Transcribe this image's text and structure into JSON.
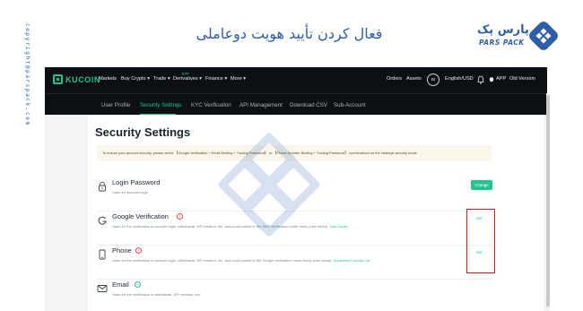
{
  "header": {
    "title": "فعال کردن تأیید هویت دوعاملی",
    "brand_name": "پارس پک",
    "brand_latin": "PARS PACK",
    "side_copyright": "copyright@parspack.com"
  },
  "nav": {
    "logo_text": "KUCOIN",
    "items": [
      "Markets",
      "Buy Crypto",
      "Trade",
      "Derivatives",
      "Finance",
      "More"
    ],
    "etf_tag": "ETF",
    "right_items": [
      "Orders",
      "Assets"
    ],
    "avatar_text": "BI",
    "language": "English/USD",
    "app": "APP",
    "old_version": "Old Version"
  },
  "tabs": {
    "items": [
      "User Profile",
      "Security Settings",
      "KYC Verification",
      "API Management",
      "Download CSV",
      "Sub-Account"
    ],
    "active": "Security Settings"
  },
  "page": {
    "title": "Security Settings",
    "notice": "To ensure your account security, please select 【Google Verification + Email Binding + Trading Password】 or 【Phone Number Binding + Trading Password】 combinations as the strategic security mode."
  },
  "rows": [
    {
      "title": "Login Password",
      "desc": "Used for account login.",
      "action": "Change",
      "icon": "lock-icon"
    },
    {
      "title": "Google Verification",
      "desc": "Used for the verification in account login, withdrawal, API creation, etc. and could switch to the SMS verification mode freely (vice versa).",
      "link": "User Guide",
      "action": "Set",
      "icon": "google-icon",
      "status": "warning"
    },
    {
      "title": "Phone",
      "desc": "Used for the verification in account login, withdrawal, API creation, etc. and could switch to the Google verification mode freely (vice versa).",
      "link": "Supported Country List",
      "action": "Set",
      "icon": "phone-icon",
      "status": "warning"
    },
    {
      "title": "Email",
      "desc": "Used for the verification in withdrawal, API creation, etc.",
      "icon": "email-icon",
      "status": "verified"
    }
  ],
  "colors": {
    "brand_blue": "#2d5ea9",
    "accent_green": "#23c38e",
    "nav_dark": "#0c1014",
    "highlight_red": "#d11a1a"
  }
}
